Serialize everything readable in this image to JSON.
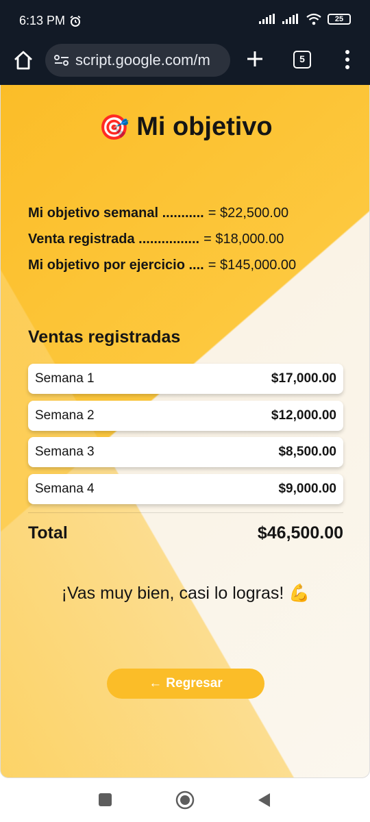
{
  "status_bar": {
    "time": "6:13 PM",
    "battery": "25"
  },
  "browser": {
    "url": "script.google.com/m",
    "tab_count": "5"
  },
  "page": {
    "title_emoji": "🎯",
    "title": "Mi objetivo",
    "goals": [
      {
        "label": "Mi objetivo semanal ...........",
        "value": "= $22,500.00"
      },
      {
        "label": "Venta registrada ................",
        "value": "= $18,000.00"
      },
      {
        "label": "Mi objetivo por ejercicio ....",
        "value": "= $145,000.00"
      }
    ],
    "sales_title": "Ventas registradas",
    "weeks": [
      {
        "label": "Semana 1",
        "amount": "$17,000.00"
      },
      {
        "label": "Semana 2",
        "amount": "$12,000.00"
      },
      {
        "label": "Semana 3",
        "amount": "$8,500.00"
      },
      {
        "label": "Semana 4",
        "amount": "$9,000.00"
      }
    ],
    "total_label": "Total",
    "total_value": "$46,500.00",
    "message": "¡Vas muy bien, casi lo logras! 💪",
    "back_arrow": "←",
    "back_label": "Regresar"
  },
  "colors": {
    "accent": "#fbbd28",
    "toolbar": "#121a26"
  }
}
